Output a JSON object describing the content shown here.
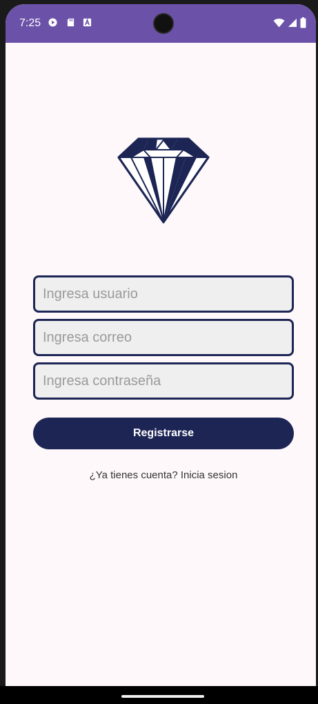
{
  "status_bar": {
    "time": "7:25",
    "icons": [
      "play-protect-icon",
      "sd-card-icon",
      "a-text-icon"
    ],
    "system_icons": [
      "wifi-icon",
      "signal-icon",
      "battery-icon"
    ]
  },
  "logo": {
    "icon": "diamond-icon",
    "color": "#1c2554"
  },
  "form": {
    "username": {
      "placeholder": "Ingresa usuario",
      "value": ""
    },
    "email": {
      "placeholder": "Ingresa correo",
      "value": ""
    },
    "password": {
      "placeholder": "Ingresa contraseña",
      "value": ""
    },
    "submit_label": "Registrarse",
    "login_link": "¿Ya tienes cuenta? Inicia sesion"
  },
  "colors": {
    "status_bar": "#6b52a8",
    "primary": "#1c2554",
    "background": "#fef8fb",
    "field_bg": "#efefef"
  }
}
